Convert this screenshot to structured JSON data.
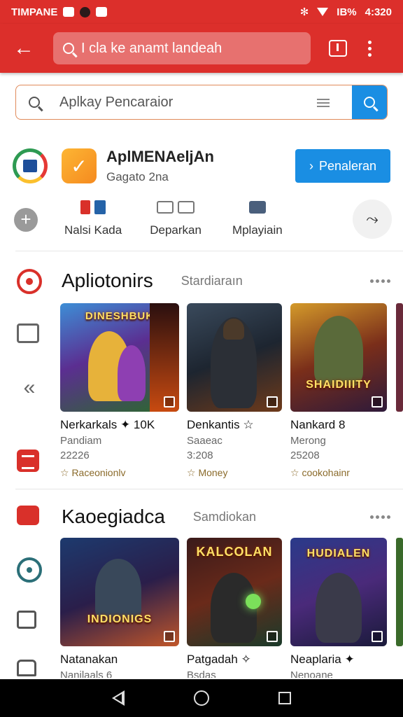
{
  "status_bar": {
    "carrier": "TIMPANE",
    "battery": "IB%",
    "time": "4:320"
  },
  "app_bar": {
    "search_text": "I cla ke anamt landeah"
  },
  "search": {
    "placeholder": "Aplkay Pencaraior"
  },
  "app_header": {
    "title": "AplMENAeljAn",
    "subtitle": "Gagato 2na",
    "install_label": "Penaleran",
    "install_prefix": "›"
  },
  "quick_actions": [
    {
      "label": "Nalsi Kada"
    },
    {
      "label": "Deparkan"
    },
    {
      "label": "Mplayiain"
    }
  ],
  "sections": [
    {
      "title": "Apliotonirs",
      "subtitle": "Stardiaraın",
      "cards": [
        {
          "art_title": "DINESHBUK",
          "name": "Nerkarkals ✦ 10K",
          "dev": "Pandiam",
          "count": "22226",
          "tag": "☆ Raceonionlv"
        },
        {
          "art_title": "",
          "name": "Denkantis ☆",
          "dev": "Saaeac",
          "count": "3:208",
          "tag": "☆ Money"
        },
        {
          "art_title": "SHAIDIIITY",
          "name": "Nankard 8",
          "dev": "Merong",
          "count": "25208",
          "tag": "☆ cookohainr"
        }
      ]
    },
    {
      "title": "Kaoegiadca",
      "subtitle": "Samdiokan",
      "cards": [
        {
          "art_title": "INDIONIGS",
          "name": "Natanakan",
          "dev": "Nanilaals 6",
          "count": "",
          "tag": ""
        },
        {
          "art_title": "KALCOLAN",
          "name": "Patgadah ✧",
          "dev": "Bsdas",
          "count": "",
          "tag": ""
        },
        {
          "art_title": "HUDIALEN",
          "name": "Neaplaria ✦",
          "dev": "Nenoane",
          "count": "",
          "tag": ""
        }
      ]
    }
  ],
  "colors": {
    "brand_red": "#dc2f2b",
    "accent_blue": "#1a8ee3"
  }
}
